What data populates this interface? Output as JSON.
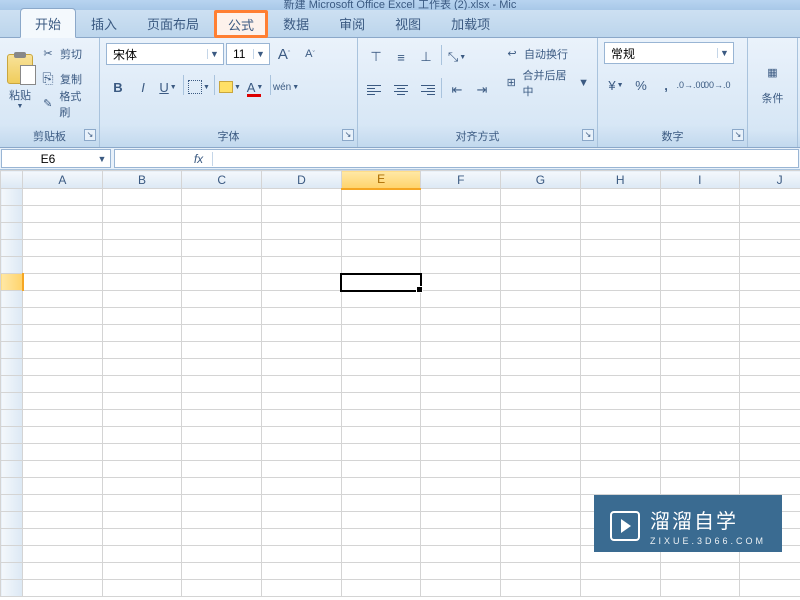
{
  "title_fragment": "新建 Microsoft Office Excel 工作表 (2).xlsx - Mic",
  "tabs": {
    "start": "开始",
    "insert": "插入",
    "layout": "页面布局",
    "formula": "公式",
    "data": "数据",
    "review": "审阅",
    "view": "视图",
    "addin": "加载项"
  },
  "clipboard": {
    "paste": "粘贴",
    "cut": "剪切",
    "copy": "复制",
    "format_painter": "格式刷",
    "group_label": "剪贴板"
  },
  "font": {
    "name": "宋体",
    "size": "11",
    "bold": "B",
    "italic": "I",
    "underline": "U",
    "grow": "A",
    "shrink": "A",
    "font_color": "A",
    "pinyin": "wén",
    "group_label": "字体"
  },
  "alignment": {
    "wrap": "自动换行",
    "merge": "合并后居中",
    "group_label": "对齐方式"
  },
  "number": {
    "format": "常规",
    "percent": "%",
    "comma": ",",
    "inc_dec": ".0",
    "dec_dec": ".00",
    "currency": "¥",
    "group_label": "数字",
    "cond": "条件"
  },
  "cell": {
    "name_box": "E6",
    "fx": "fx"
  },
  "columns": [
    "A",
    "B",
    "C",
    "D",
    "E",
    "F",
    "G",
    "H",
    "I",
    "J"
  ],
  "selected_col_index": 4,
  "selected_row_index": 5,
  "watermark": {
    "brand": "溜溜自学",
    "domain": "ZIXUE.3D66.COM"
  }
}
